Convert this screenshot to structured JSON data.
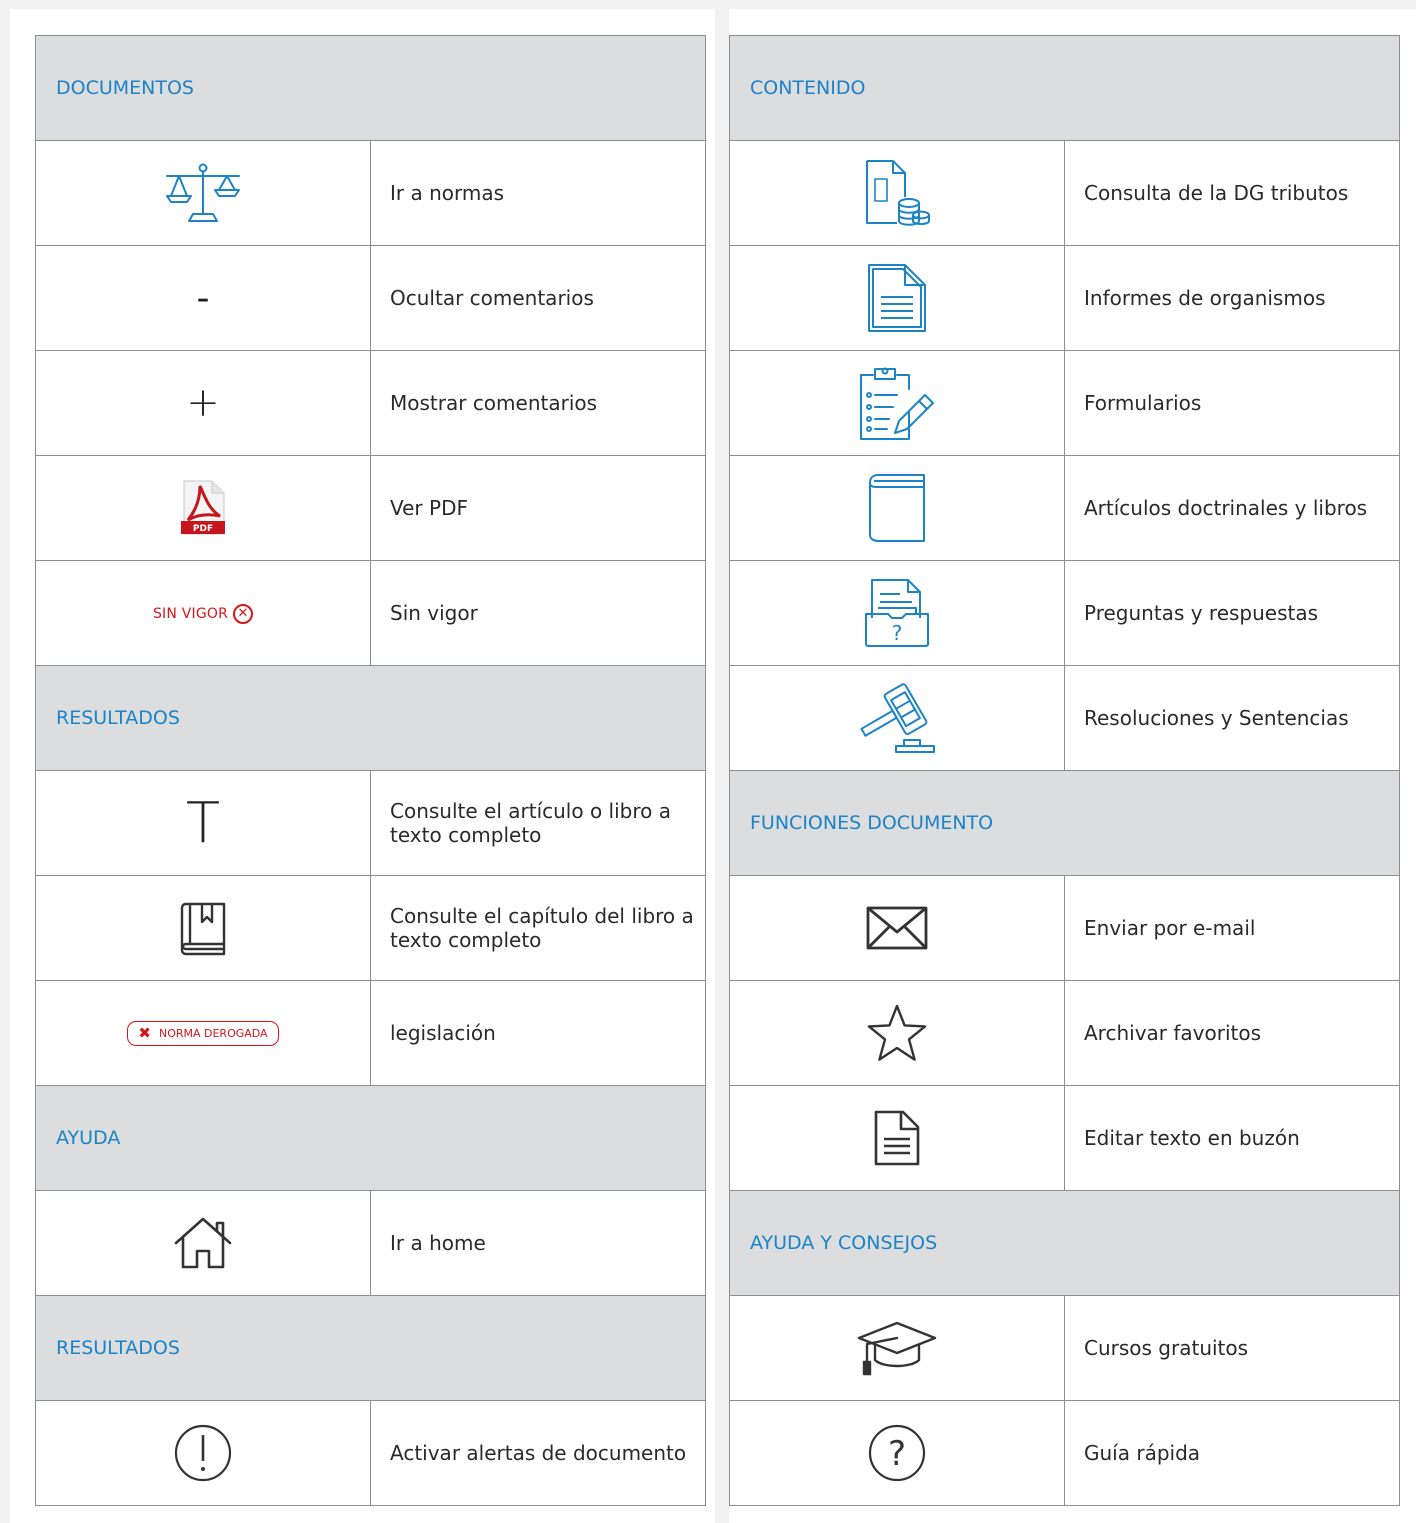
{
  "left": {
    "sections": [
      {
        "title": "DOCUMENTOS",
        "rows": [
          {
            "icon": "scales-icon",
            "label": "Ir a normas"
          },
          {
            "icon": "minus-icon",
            "glyph": "-",
            "label": "Ocultar comentarios"
          },
          {
            "icon": "plus-icon",
            "glyph": "+",
            "label": "Mostrar comentarios"
          },
          {
            "icon": "pdf-icon",
            "icon_text": "PDF",
            "label": "Ver PDF"
          },
          {
            "icon": "sin-vigor-badge",
            "badge_text": "SIN VIGOR",
            "label": "Sin vigor"
          }
        ]
      },
      {
        "title": "RESULTADOS",
        "rows": [
          {
            "icon": "text-t-icon",
            "glyph": "T",
            "label": "Consulte el artículo o libro a texto completo"
          },
          {
            "icon": "book-bookmark-icon",
            "label": "Consulte el capítulo del libro a texto completo"
          },
          {
            "icon": "norma-derogada-badge",
            "badge_text": "NORMA DEROGADA",
            "label": "legislación"
          }
        ]
      },
      {
        "title": "AYUDA",
        "rows": [
          {
            "icon": "home-icon",
            "label": "Ir a home"
          }
        ]
      },
      {
        "title": "RESULTADOS",
        "rows": [
          {
            "icon": "alert-circle-icon",
            "label": "Activar alertas de documento"
          }
        ]
      }
    ]
  },
  "right": {
    "sections": [
      {
        "title": "CONTENIDO",
        "rows": [
          {
            "icon": "document-coins-icon",
            "label": "Consulta de la DG tributos"
          },
          {
            "icon": "document-lines-icon",
            "label": "Informes de organismos"
          },
          {
            "icon": "clipboard-pencil-icon",
            "label": "Formularios"
          },
          {
            "icon": "closed-book-icon",
            "label": "Artículos doctrinales y libros"
          },
          {
            "icon": "document-question-icon",
            "icon_text": "?",
            "label": "Preguntas y respuestas"
          },
          {
            "icon": "gavel-icon",
            "label": "Resoluciones y Sentencias"
          }
        ]
      },
      {
        "title": "FUNCIONES DOCUMENTO",
        "rows": [
          {
            "icon": "envelope-icon",
            "label": "Enviar por e-mail"
          },
          {
            "icon": "star-icon",
            "label": "Archivar favoritos"
          },
          {
            "icon": "document-edit-icon",
            "label": "Editar texto en buzón"
          }
        ]
      },
      {
        "title": "AYUDA Y CONSEJOS",
        "rows": [
          {
            "icon": "graduation-cap-icon",
            "label": "Cursos gratuitos"
          },
          {
            "icon": "question-circle-icon",
            "icon_text": "?",
            "label": "Guía rápida"
          }
        ]
      }
    ]
  },
  "colors": {
    "accent_blue": "#1d83c7",
    "header_bg": "#dcdddf",
    "alert_red": "#d8151b",
    "pdf_red": "#c4161c"
  }
}
